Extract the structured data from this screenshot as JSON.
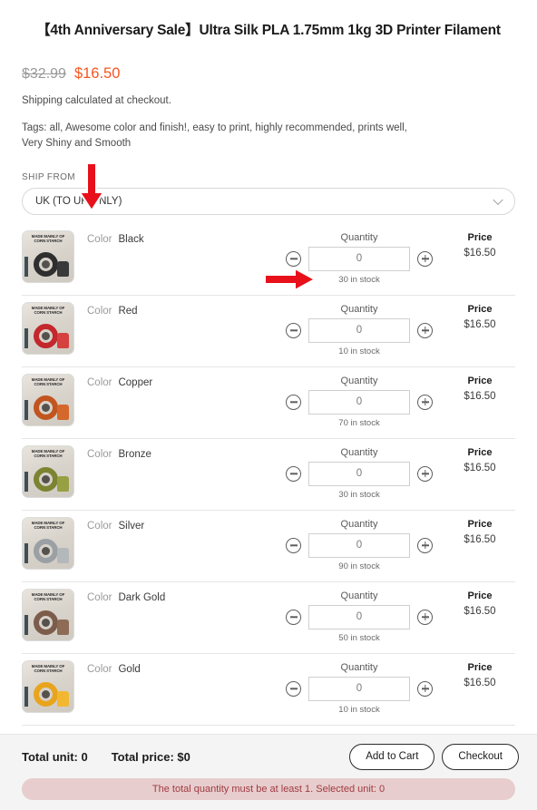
{
  "product": {
    "title": "【4th Anniversary Sale】Ultra Silk PLA 1.75mm 1kg 3D Printer Filament",
    "price_original": "$32.99",
    "price_sale": "$16.50",
    "shipping_note": "Shipping calculated at checkout.",
    "tags_text": "Tags: all, Awesome color and finish!, easy to print, highly recommended, prints well, Very Shiny and Smooth"
  },
  "ship_from": {
    "label": "SHIP FROM",
    "selected": "UK (TO UK ONLY)",
    "chevron_icon": "chevron-down-icon"
  },
  "column_headers": {
    "quantity": "Quantity",
    "price": "Price"
  },
  "variants": [
    {
      "color_key": "Color",
      "color_value": "Black",
      "quantity": "0",
      "stock": "30 in stock",
      "price": "$16.50",
      "thumb_spool": "#2f2f2f",
      "thumb_figure": "#3a3a3a"
    },
    {
      "color_key": "Color",
      "color_value": "Red",
      "quantity": "0",
      "stock": "10 in stock",
      "price": "$16.50",
      "thumb_spool": "#c3282c",
      "thumb_figure": "#d6413f"
    },
    {
      "color_key": "Color",
      "color_value": "Copper",
      "quantity": "0",
      "stock": "70 in stock",
      "price": "$16.50",
      "thumb_spool": "#c2551f",
      "thumb_figure": "#d4682c"
    },
    {
      "color_key": "Color",
      "color_value": "Bronze",
      "quantity": "0",
      "stock": "30 in stock",
      "price": "$16.50",
      "thumb_spool": "#7d8331",
      "thumb_figure": "#97a043"
    },
    {
      "color_key": "Color",
      "color_value": "Silver",
      "quantity": "0",
      "stock": "90 in stock",
      "price": "$16.50",
      "thumb_spool": "#9aa0a4",
      "thumb_figure": "#b3b8bb"
    },
    {
      "color_key": "Color",
      "color_value": "Dark Gold",
      "quantity": "0",
      "stock": "50 in stock",
      "price": "$16.50",
      "thumb_spool": "#7c5c4a",
      "thumb_figure": "#8e6b55"
    },
    {
      "color_key": "Color",
      "color_value": "Gold",
      "quantity": "0",
      "stock": "10 in stock",
      "price": "$16.50",
      "thumb_spool": "#e8a41d",
      "thumb_figure": "#f2b731"
    }
  ],
  "thumbnail_banner_text": "MADE MAINLY OF CORN STARCH",
  "stepper": {
    "decrement_icon": "minus-circle-icon",
    "increment_icon": "plus-circle-icon"
  },
  "footer": {
    "total_unit": "Total unit: 0",
    "total_price": "Total price:  $0",
    "add_to_cart": "Add to Cart",
    "checkout": "Checkout",
    "error_message": "The total quantity must be at least 1. Selected unit: 0"
  },
  "annotations": {
    "arrow_color": "#e8111b",
    "down_arrow": "arrow-down-annotation",
    "right_arrow": "arrow-right-annotation"
  }
}
